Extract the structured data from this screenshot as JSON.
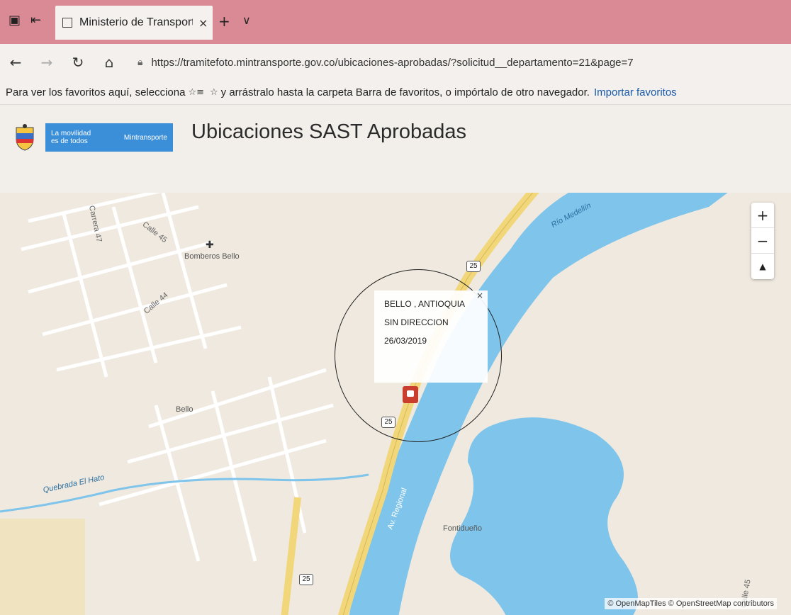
{
  "browser": {
    "tab_title": "Ministerio de Transporte",
    "tab_close": "×",
    "new_tab": "+",
    "tab_menu": "∨",
    "url": "https://tramitefoto.mintransporte.gov.co/ubicaciones-aprobadas/?solicitud__departamento=21&page=7"
  },
  "favorites_bar": {
    "text_before": "Para ver los favoritos aquí, selecciona",
    "text_after": "y arrástralo hasta la carpeta Barra de favoritos, o impórtalo de otro navegador.",
    "import_link": "Importar favoritos"
  },
  "header": {
    "brand_line1": "La movilidad",
    "brand_line2": "es de todos",
    "brand_right": "Mintransporte",
    "title": "Ubicaciones SAST Aprobadas"
  },
  "map": {
    "labels": {
      "bomberos": "Bomberos Bello",
      "bello": "Bello",
      "fontidueno": "Fontidueño",
      "calle45": "Calle 45",
      "calle44": "Calle 44",
      "carrera47": "Carrera 47",
      "quebrada": "Quebrada El Hato",
      "rio": "Río Medellín",
      "av_regional": "Av. Regional",
      "calle45b": "Calle 45"
    },
    "shields": [
      "25",
      "25",
      "25"
    ],
    "zoom_in": "+",
    "zoom_out": "−",
    "compass": "▲",
    "attribution": "© OpenMapTiles © OpenStreetMap contributors"
  },
  "popup": {
    "close": "×",
    "location": "BELLO , ANTIOQUIA",
    "address": "SIN DIRECCION",
    "date": "26/03/2019"
  },
  "colors": {
    "tabbar": "#d98a94",
    "river": "#7fc4ea",
    "road": "#f1d77a",
    "brand": "#3b8fd8",
    "marker": "#c93e2c"
  }
}
